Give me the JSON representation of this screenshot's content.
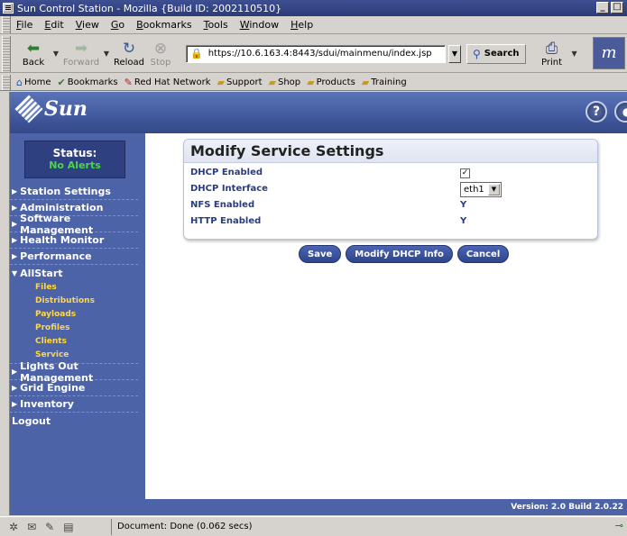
{
  "window": {
    "title": "Sun Control Station - Mozilla {Build ID: 2002110510}"
  },
  "menubar": {
    "items": [
      "File",
      "Edit",
      "View",
      "Go",
      "Bookmarks",
      "Tools",
      "Window",
      "Help"
    ]
  },
  "toolbar": {
    "back": "Back",
    "forward": "Forward",
    "reload": "Reload",
    "stop": "Stop",
    "url": "https://10.6.163.4:8443/sdui/mainmenu/index.jsp",
    "search": "Search",
    "print": "Print"
  },
  "bookmarks": [
    "Home",
    "Bookmarks",
    "Red Hat Network",
    "Support",
    "Shop",
    "Products",
    "Training"
  ],
  "sidebar": {
    "status_label": "Status:",
    "status_value": "No Alerts",
    "items": [
      "Station Settings",
      "Administration",
      "Software Management",
      "Health Monitor",
      "Performance",
      "AllStart"
    ],
    "allstart_sub": [
      "Files",
      "Distributions",
      "Payloads",
      "Profiles",
      "Clients",
      "Service"
    ],
    "items_after": [
      "Lights Out Management",
      "Grid Engine",
      "Inventory"
    ],
    "logout": "Logout"
  },
  "panel": {
    "title": "Modify Service Settings",
    "rows": [
      {
        "label": "DHCP Enabled",
        "kind": "checkbox",
        "checked": true
      },
      {
        "label": "DHCP Interface",
        "kind": "select",
        "value": "eth1"
      },
      {
        "label": "NFS Enabled",
        "kind": "text",
        "value": "Y"
      },
      {
        "label": "HTTP Enabled",
        "kind": "text",
        "value": "Y"
      }
    ]
  },
  "buttons": {
    "save": "Save",
    "modify_dhcp": "Modify DHCP Info",
    "cancel": "Cancel"
  },
  "version": "Version: 2.0 Build 2.0.22",
  "statusbar": {
    "text": "Document: Done (0.062 secs)"
  },
  "colors": {
    "sidebar_bg": "#4d63a8",
    "accent_yellow": "#ffd84a",
    "alert_green": "#4dd34d",
    "label_blue": "#2a3c80"
  }
}
